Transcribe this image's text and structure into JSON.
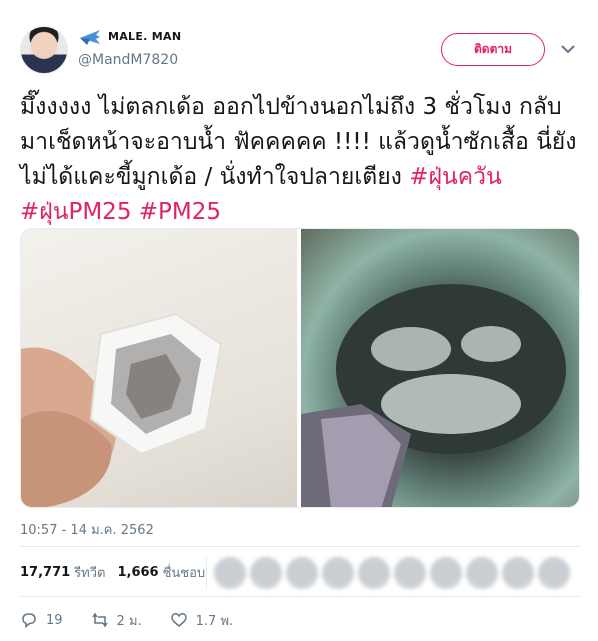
{
  "user": {
    "display_name": "MALE. MAN",
    "handle": "@MandM7820",
    "follow_label": "ติดตาม"
  },
  "tweet": {
    "text_plain": "มึ๊งงงงง ไม่ตลกเด้อ ออกไปข้างนอกไม่ถึง 3 ชั่วโมง กลับมาเช็ดหน้าจะอาบน้ำ ฟัคคคคค !!!! แล้วดูน้ำซักเสื้อ นี่ยังไม่ได้แคะขี้มูกเด้อ / นั่งทำใจปลายเตียง",
    "hashtags": [
      "#ฝุ่นควัน",
      "#ฝุ่นPM25",
      "#PM25"
    ],
    "timestamp": "10:57 - 14 ม.ค. 2562"
  },
  "stats": {
    "retweets_count": "17,771",
    "retweets_label": "รีทวีต",
    "likes_count": "1,666",
    "likes_label": "ชื่นชอบ"
  },
  "actions": {
    "reply_count": "19",
    "retweet_count": "2 ม.",
    "like_count": "1.7 พ."
  },
  "colors": {
    "accent": "#e0245e",
    "muted": "#657786",
    "text": "#14171a",
    "border": "#e6ecf0"
  },
  "icons": [
    "plane-icon",
    "chevron-down-icon",
    "reply-icon",
    "retweet-icon",
    "heart-icon"
  ]
}
